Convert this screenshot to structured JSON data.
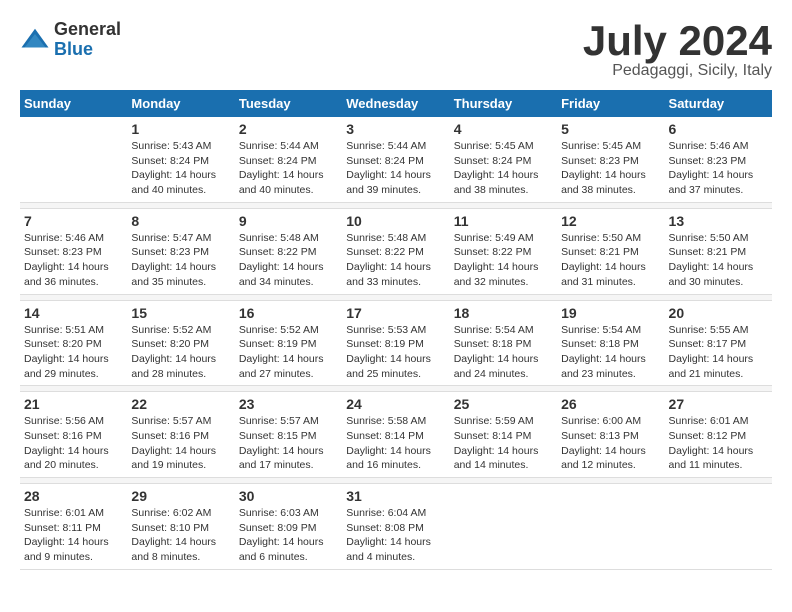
{
  "logo": {
    "general": "General",
    "blue": "Blue"
  },
  "title": "July 2024",
  "location": "Pedagaggi, Sicily, Italy",
  "days_of_week": [
    "Sunday",
    "Monday",
    "Tuesday",
    "Wednesday",
    "Thursday",
    "Friday",
    "Saturday"
  ],
  "weeks": [
    [
      {
        "day": "",
        "info": ""
      },
      {
        "day": "1",
        "info": "Sunrise: 5:43 AM\nSunset: 8:24 PM\nDaylight: 14 hours\nand 40 minutes."
      },
      {
        "day": "2",
        "info": "Sunrise: 5:44 AM\nSunset: 8:24 PM\nDaylight: 14 hours\nand 40 minutes."
      },
      {
        "day": "3",
        "info": "Sunrise: 5:44 AM\nSunset: 8:24 PM\nDaylight: 14 hours\nand 39 minutes."
      },
      {
        "day": "4",
        "info": "Sunrise: 5:45 AM\nSunset: 8:24 PM\nDaylight: 14 hours\nand 38 minutes."
      },
      {
        "day": "5",
        "info": "Sunrise: 5:45 AM\nSunset: 8:23 PM\nDaylight: 14 hours\nand 38 minutes."
      },
      {
        "day": "6",
        "info": "Sunrise: 5:46 AM\nSunset: 8:23 PM\nDaylight: 14 hours\nand 37 minutes."
      }
    ],
    [
      {
        "day": "7",
        "info": "Sunrise: 5:46 AM\nSunset: 8:23 PM\nDaylight: 14 hours\nand 36 minutes."
      },
      {
        "day": "8",
        "info": "Sunrise: 5:47 AM\nSunset: 8:23 PM\nDaylight: 14 hours\nand 35 minutes."
      },
      {
        "day": "9",
        "info": "Sunrise: 5:48 AM\nSunset: 8:22 PM\nDaylight: 14 hours\nand 34 minutes."
      },
      {
        "day": "10",
        "info": "Sunrise: 5:48 AM\nSunset: 8:22 PM\nDaylight: 14 hours\nand 33 minutes."
      },
      {
        "day": "11",
        "info": "Sunrise: 5:49 AM\nSunset: 8:22 PM\nDaylight: 14 hours\nand 32 minutes."
      },
      {
        "day": "12",
        "info": "Sunrise: 5:50 AM\nSunset: 8:21 PM\nDaylight: 14 hours\nand 31 minutes."
      },
      {
        "day": "13",
        "info": "Sunrise: 5:50 AM\nSunset: 8:21 PM\nDaylight: 14 hours\nand 30 minutes."
      }
    ],
    [
      {
        "day": "14",
        "info": "Sunrise: 5:51 AM\nSunset: 8:20 PM\nDaylight: 14 hours\nand 29 minutes."
      },
      {
        "day": "15",
        "info": "Sunrise: 5:52 AM\nSunset: 8:20 PM\nDaylight: 14 hours\nand 28 minutes."
      },
      {
        "day": "16",
        "info": "Sunrise: 5:52 AM\nSunset: 8:19 PM\nDaylight: 14 hours\nand 27 minutes."
      },
      {
        "day": "17",
        "info": "Sunrise: 5:53 AM\nSunset: 8:19 PM\nDaylight: 14 hours\nand 25 minutes."
      },
      {
        "day": "18",
        "info": "Sunrise: 5:54 AM\nSunset: 8:18 PM\nDaylight: 14 hours\nand 24 minutes."
      },
      {
        "day": "19",
        "info": "Sunrise: 5:54 AM\nSunset: 8:18 PM\nDaylight: 14 hours\nand 23 minutes."
      },
      {
        "day": "20",
        "info": "Sunrise: 5:55 AM\nSunset: 8:17 PM\nDaylight: 14 hours\nand 21 minutes."
      }
    ],
    [
      {
        "day": "21",
        "info": "Sunrise: 5:56 AM\nSunset: 8:16 PM\nDaylight: 14 hours\nand 20 minutes."
      },
      {
        "day": "22",
        "info": "Sunrise: 5:57 AM\nSunset: 8:16 PM\nDaylight: 14 hours\nand 19 minutes."
      },
      {
        "day": "23",
        "info": "Sunrise: 5:57 AM\nSunset: 8:15 PM\nDaylight: 14 hours\nand 17 minutes."
      },
      {
        "day": "24",
        "info": "Sunrise: 5:58 AM\nSunset: 8:14 PM\nDaylight: 14 hours\nand 16 minutes."
      },
      {
        "day": "25",
        "info": "Sunrise: 5:59 AM\nSunset: 8:14 PM\nDaylight: 14 hours\nand 14 minutes."
      },
      {
        "day": "26",
        "info": "Sunrise: 6:00 AM\nSunset: 8:13 PM\nDaylight: 14 hours\nand 12 minutes."
      },
      {
        "day": "27",
        "info": "Sunrise: 6:01 AM\nSunset: 8:12 PM\nDaylight: 14 hours\nand 11 minutes."
      }
    ],
    [
      {
        "day": "28",
        "info": "Sunrise: 6:01 AM\nSunset: 8:11 PM\nDaylight: 14 hours\nand 9 minutes."
      },
      {
        "day": "29",
        "info": "Sunrise: 6:02 AM\nSunset: 8:10 PM\nDaylight: 14 hours\nand 8 minutes."
      },
      {
        "day": "30",
        "info": "Sunrise: 6:03 AM\nSunset: 8:09 PM\nDaylight: 14 hours\nand 6 minutes."
      },
      {
        "day": "31",
        "info": "Sunrise: 6:04 AM\nSunset: 8:08 PM\nDaylight: 14 hours\nand 4 minutes."
      },
      {
        "day": "",
        "info": ""
      },
      {
        "day": "",
        "info": ""
      },
      {
        "day": "",
        "info": ""
      }
    ]
  ]
}
